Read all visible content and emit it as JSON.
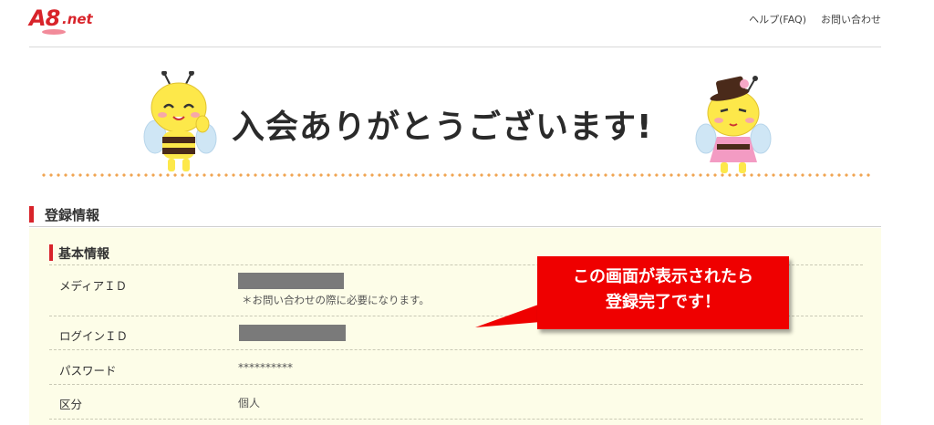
{
  "header": {
    "logo_main": "A8",
    "logo_net": ".net",
    "links": [
      "ヘルプ(FAQ)",
      "お問い合わせ"
    ]
  },
  "banner": {
    "title": "入会ありがとうございます!"
  },
  "section": {
    "title": "登録情報"
  },
  "panel": {
    "subtitle": "基本情報",
    "rows": [
      {
        "label": "メディアＩＤ",
        "value": "",
        "note": "＊お問い合わせの際に必要になります。"
      },
      {
        "label": "ログインＩＤ",
        "value": ""
      },
      {
        "label": "パスワード",
        "value": "**********"
      },
      {
        "label": "区分",
        "value": "個人"
      }
    ]
  },
  "callout": {
    "line1": "この画面が表示されたら",
    "line2": "登録完了です！"
  },
  "colors": {
    "brand_red": "#d8232a",
    "callout_red": "#ef0000",
    "panel_bg": "#fdfde8",
    "dots": "#f0a552"
  }
}
